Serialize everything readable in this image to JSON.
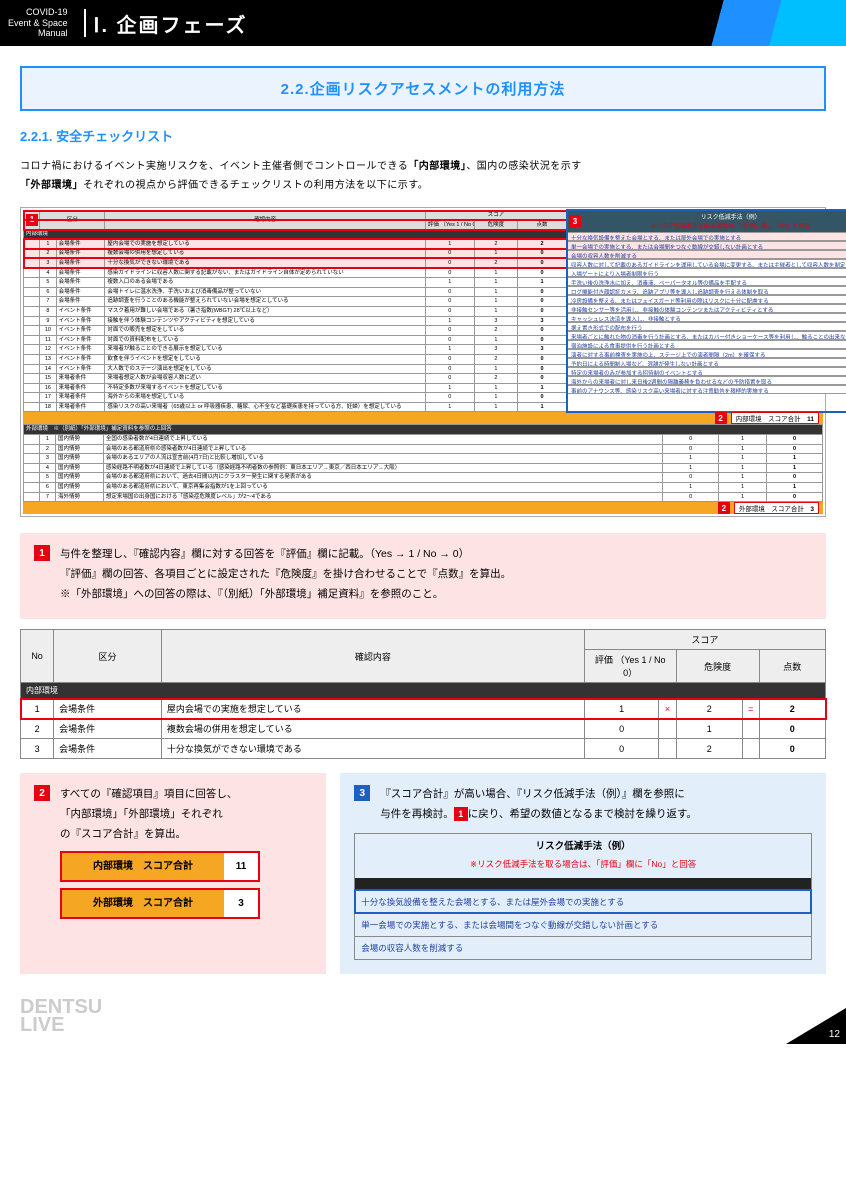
{
  "header": {
    "label_l1": "COVID-19",
    "label_l2": "Event & Space",
    "label_l3": "Manual",
    "title": "Ⅰ. 企画フェーズ"
  },
  "banner": "2.2.企画リスクアセスメントの利用方法",
  "subsection": "2.2.1. 安全チェックリスト",
  "intro_l1_a": "コロナ禍におけるイベント実施リスクを、イベント主催者側でコントロールできる",
  "intro_l1_b": "「内部環境」",
  "intro_l1_c": "、国内の感染状況を示す",
  "intro_l2_a": "「外部環境」",
  "intro_l2_b": "それぞれの視点から評価できるチェックリストの利用方法を以下に示す。",
  "badge1": "1",
  "badge2": "2",
  "badge3": "3",
  "ss_head": {
    "kubun": "区分",
    "kakunin": "確認内容",
    "score": "スコア",
    "hyoka": "評価\n（Yes 1 / No 0）",
    "kiken": "危険度",
    "ten": "点数"
  },
  "side_head_title": "リスク低減手法（例）",
  "side_head_note": "※リスク低減手法を取る場合は、「評価」欄に「No」と回答",
  "cat_internal": "内部環境",
  "rows_int": [
    {
      "n": "1",
      "k": "会場条件",
      "c": "屋内会場での実施を想定している",
      "h": "1",
      "d": "2",
      "t": "2"
    },
    {
      "n": "2",
      "k": "会場条件",
      "c": "複数会場の併用を想定している",
      "h": "0",
      "d": "1",
      "t": "0"
    },
    {
      "n": "3",
      "k": "会場条件",
      "c": "十分な換気ができない環境である",
      "h": "0",
      "d": "2",
      "t": "0"
    },
    {
      "n": "4",
      "k": "会場条件",
      "c": "感染ガイドラインに収容人数に関する記載がない、またはガイドライン自体が定められていない",
      "h": "0",
      "d": "1",
      "t": "0"
    },
    {
      "n": "5",
      "k": "会場条件",
      "c": "複数入口のある会場である",
      "h": "1",
      "d": "1",
      "t": "1"
    },
    {
      "n": "6",
      "k": "会場条件",
      "c": "会場トイレに温水洗浄、手洗いおよび消毒備品が整っていない",
      "h": "0",
      "d": "1",
      "t": "0"
    },
    {
      "n": "7",
      "k": "会場条件",
      "c": "追跡調査を行うことのある機能が整えられていない会場を想定としている",
      "h": "0",
      "d": "1",
      "t": "0"
    },
    {
      "n": "8",
      "k": "イベント条件",
      "c": "マスク着用が難しい会場である（暑さ指数(WBGT) 28℃以上など）",
      "h": "0",
      "d": "1",
      "t": "0"
    },
    {
      "n": "9",
      "k": "イベント条件",
      "c": "接触を伴う体験コンテンツやアクティビティを想定している",
      "h": "1",
      "d": "3",
      "t": "3"
    },
    {
      "n": "10",
      "k": "イベント条件",
      "c": "対面での販売を想定をしている",
      "h": "0",
      "d": "2",
      "t": "0"
    },
    {
      "n": "11",
      "k": "イベント条件",
      "c": "対面での資料配布をしている",
      "h": "0",
      "d": "1",
      "t": "0"
    },
    {
      "n": "12",
      "k": "イベント条件",
      "c": "来場者が触ることのできる展示を想定している",
      "h": "1",
      "d": "3",
      "t": "3"
    },
    {
      "n": "13",
      "k": "イベント条件",
      "c": "飲食を伴うイベントを想定をしている",
      "h": "0",
      "d": "2",
      "t": "0"
    },
    {
      "n": "14",
      "k": "イベント条件",
      "c": "大人数でのステージ演出を想定をしている",
      "h": "0",
      "d": "1",
      "t": "0"
    },
    {
      "n": "15",
      "k": "来場者条件",
      "c": "来場者想定人数が会場収容人数に近い",
      "h": "0",
      "d": "2",
      "t": "0"
    },
    {
      "n": "16",
      "k": "来場者条件",
      "c": "不特定多数が来場するイベントを想定している",
      "h": "1",
      "d": "1",
      "t": "1"
    },
    {
      "n": "17",
      "k": "来場者条件",
      "c": "海外からの来場を想定している",
      "h": "0",
      "d": "1",
      "t": "0"
    },
    {
      "n": "18",
      "k": "来場者条件",
      "c": "感染リスクの高い来場者（65歳以上 or 呼吸器疾患、糖尿、心不全など基礎疾患を持っている方、妊婦）を想定している",
      "h": "1",
      "d": "1",
      "t": "1"
    }
  ],
  "side_rows": [
    "十分な換気設備を整えた会場とする、または屋外会場での実施とする",
    "単一会場での実施とする、または会場間をつなぐ動線が交錯しない計画とする",
    "会場の収容人数を削減する"
  ],
  "side_rows2": [
    "収容人数に対して記載のあるガイドラインを運用している会場に変更する、または主催者として収容人数を制定する",
    "入場ゲートにより入場者制限を行う",
    "手洗い後の洗浄水に加え、消毒液、ペーパータオル等の備品を手配する",
    "ログ機能付き顔認証カメラ、追跡アプリ等を導入し追跡調査を行える体制を取る",
    "冷房設備を整える、またはフェイスガード等利用の際はリスクに十分に配慮する",
    "非接触センサー等を活用し、非接触の体験コンテンツまたはアクティビティとする",
    "キャッシュレス決済を導入し、非接触とする",
    "据え置き形式での配布を行う",
    "来場者ごとに触れた物の消毒を行う計画とする、またはカバー付きショーケース等を利用し、触ることの出来ない展示とする",
    "宿泊施設による食事提供を行う計画とする",
    "演者に対する事前検査を実施の上、ステージ上での演者間隔（2m）を確保する",
    "予約日による時間制入場など、混雑が発生しない計画とする",
    "特定の来場者のみが参加する招待制のイベントとする",
    "海外からの来場者に対し来日後2週間の隔離義務を負わせるなどの予防措置を取る",
    "事前のアナウンス等、感染リスク高い来場者に対する注意勧告を積極的実施する"
  ],
  "sum_int_label": "内部環境　スコア合計",
  "sum_int_val": "11",
  "cat_ext_head": "外部環境　※（別紙）「外部環境」補足資料を参照の上回答",
  "rows_ext": [
    {
      "n": "1",
      "k": "国内情勢",
      "c": "全国の感染者数が4日連続で上昇している",
      "h": "0",
      "d": "1",
      "t": "0"
    },
    {
      "n": "2",
      "k": "国内情勢",
      "c": "会場のある都道府県の感染者数が4日連続で上昇している",
      "h": "0",
      "d": "1",
      "t": "0"
    },
    {
      "n": "3",
      "k": "国内情勢",
      "c": "会場のあるエリアの人流は宣言前(4月7日)と比較し増加している",
      "h": "1",
      "d": "1",
      "t": "1"
    },
    {
      "n": "4",
      "k": "国内情勢",
      "c": "感染経路不明者数が4日連続で上昇している（感染経路不明者数の参照例：東日本エリア→東京／西日本エリア→大阪）",
      "h": "1",
      "d": "1",
      "t": "1"
    },
    {
      "n": "5",
      "k": "国内情勢",
      "c": "会場のある都道府県において、過去4日間以内にクラスター発生に関する発表がある",
      "h": "0",
      "d": "1",
      "t": "0"
    },
    {
      "n": "6",
      "k": "国内情勢",
      "c": "会場のある都道府県において、東京再集会指数が1を上回っている",
      "h": "1",
      "d": "1",
      "t": "1"
    },
    {
      "n": "7",
      "k": "海外情勢",
      "c": "想定来場国の出身国における「感染症危険度レベル」が2〜4である",
      "h": "0",
      "d": "1",
      "t": "0"
    }
  ],
  "sum_ext_label": "外部環境　スコア合計",
  "sum_ext_val": "3",
  "step1_l1": "与件を整理し、『確認内容』欄に対する回答を『評価』欄に記載。（Yes → 1 / No → 0）",
  "step1_l2": "『評価』欄の回答、各項目ごとに設定された『危険度』を掛け合わせることで『点数』を算出。",
  "step1_l3": "※「外部環境」への回答の際は、『（別紙）「外部環境」補足資料』を参照のこと。",
  "mini_head": {
    "no": "No",
    "kubun": "区分",
    "kakunin": "確認内容",
    "score": "スコア",
    "hyoka": "評価\n（Yes 1 / No 0）",
    "kiken": "危険度",
    "ten": "点数"
  },
  "mini_cat": "内部環境",
  "mini_rows": [
    {
      "n": "1",
      "k": "会場条件",
      "c": "屋内会場での実施を想定している",
      "h": "1",
      "op1": "×",
      "d": "2",
      "op2": "=",
      "t": "2",
      "hl": true
    },
    {
      "n": "2",
      "k": "会場条件",
      "c": "複数会場の併用を想定している",
      "h": "0",
      "op1": "",
      "d": "1",
      "op2": "",
      "t": "0"
    },
    {
      "n": "3",
      "k": "会場条件",
      "c": "十分な換気ができない環境である",
      "h": "0",
      "op1": "",
      "d": "2",
      "op2": "",
      "t": "0"
    }
  ],
  "step2_l1": "すべての『確認項目』項目に回答し、",
  "step2_l2": "「内部環境」「外部環境」それぞれ",
  "step2_l3": "の『スコア合計』を算出。",
  "pill1_label": "内部環境　スコア合計",
  "pill1_val": "11",
  "pill2_label": "外部環境　スコア合計",
  "pill2_val": "3",
  "step3_l1a": "『スコア合計』が高い場合、『リスク低減手法（例）』欄を参照に",
  "step3_l2a": "与件を再検討。",
  "step3_l2b": "に戻り、希望の数値となるまで検討を繰り返す。",
  "risk_title": "リスク低減手法（例）",
  "risk_note": "※リスク低減手法を取る場合は、「評価」欄に「No」と回答",
  "risk_rows": [
    "十分な換気設備を整えた会場とする、または屋外会場での実施とする",
    "単一会場での実施とする、または会場間をつなぐ動線が交錯しない計画とする",
    "会場の収容人数を削減する"
  ],
  "logo_l1": "DENTSU",
  "logo_l2": "LIVE",
  "page_num": "12"
}
